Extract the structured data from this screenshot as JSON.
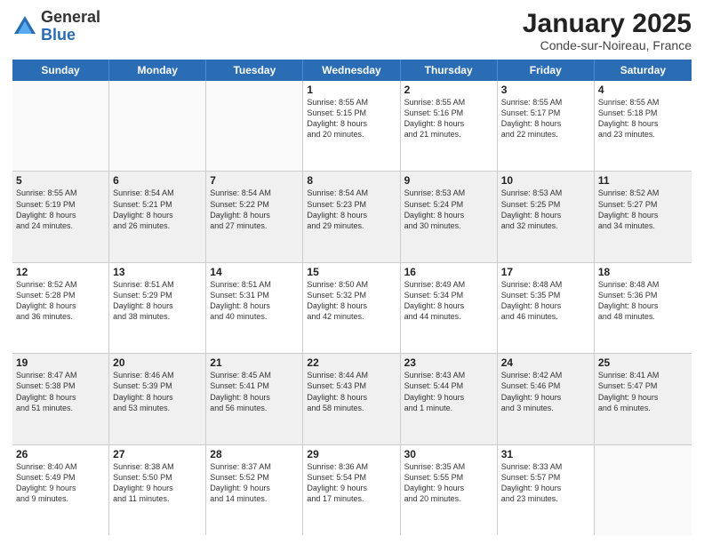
{
  "header": {
    "logo_general": "General",
    "logo_blue": "Blue",
    "title": "January 2025",
    "location": "Conde-sur-Noireau, France"
  },
  "calendar": {
    "days_of_week": [
      "Sunday",
      "Monday",
      "Tuesday",
      "Wednesday",
      "Thursday",
      "Friday",
      "Saturday"
    ],
    "weeks": [
      [
        {
          "day": "",
          "text": ""
        },
        {
          "day": "",
          "text": ""
        },
        {
          "day": "",
          "text": ""
        },
        {
          "day": "1",
          "text": "Sunrise: 8:55 AM\nSunset: 5:15 PM\nDaylight: 8 hours\nand 20 minutes."
        },
        {
          "day": "2",
          "text": "Sunrise: 8:55 AM\nSunset: 5:16 PM\nDaylight: 8 hours\nand 21 minutes."
        },
        {
          "day": "3",
          "text": "Sunrise: 8:55 AM\nSunset: 5:17 PM\nDaylight: 8 hours\nand 22 minutes."
        },
        {
          "day": "4",
          "text": "Sunrise: 8:55 AM\nSunset: 5:18 PM\nDaylight: 8 hours\nand 23 minutes."
        }
      ],
      [
        {
          "day": "5",
          "text": "Sunrise: 8:55 AM\nSunset: 5:19 PM\nDaylight: 8 hours\nand 24 minutes."
        },
        {
          "day": "6",
          "text": "Sunrise: 8:54 AM\nSunset: 5:21 PM\nDaylight: 8 hours\nand 26 minutes."
        },
        {
          "day": "7",
          "text": "Sunrise: 8:54 AM\nSunset: 5:22 PM\nDaylight: 8 hours\nand 27 minutes."
        },
        {
          "day": "8",
          "text": "Sunrise: 8:54 AM\nSunset: 5:23 PM\nDaylight: 8 hours\nand 29 minutes."
        },
        {
          "day": "9",
          "text": "Sunrise: 8:53 AM\nSunset: 5:24 PM\nDaylight: 8 hours\nand 30 minutes."
        },
        {
          "day": "10",
          "text": "Sunrise: 8:53 AM\nSunset: 5:25 PM\nDaylight: 8 hours\nand 32 minutes."
        },
        {
          "day": "11",
          "text": "Sunrise: 8:52 AM\nSunset: 5:27 PM\nDaylight: 8 hours\nand 34 minutes."
        }
      ],
      [
        {
          "day": "12",
          "text": "Sunrise: 8:52 AM\nSunset: 5:28 PM\nDaylight: 8 hours\nand 36 minutes."
        },
        {
          "day": "13",
          "text": "Sunrise: 8:51 AM\nSunset: 5:29 PM\nDaylight: 8 hours\nand 38 minutes."
        },
        {
          "day": "14",
          "text": "Sunrise: 8:51 AM\nSunset: 5:31 PM\nDaylight: 8 hours\nand 40 minutes."
        },
        {
          "day": "15",
          "text": "Sunrise: 8:50 AM\nSunset: 5:32 PM\nDaylight: 8 hours\nand 42 minutes."
        },
        {
          "day": "16",
          "text": "Sunrise: 8:49 AM\nSunset: 5:34 PM\nDaylight: 8 hours\nand 44 minutes."
        },
        {
          "day": "17",
          "text": "Sunrise: 8:48 AM\nSunset: 5:35 PM\nDaylight: 8 hours\nand 46 minutes."
        },
        {
          "day": "18",
          "text": "Sunrise: 8:48 AM\nSunset: 5:36 PM\nDaylight: 8 hours\nand 48 minutes."
        }
      ],
      [
        {
          "day": "19",
          "text": "Sunrise: 8:47 AM\nSunset: 5:38 PM\nDaylight: 8 hours\nand 51 minutes."
        },
        {
          "day": "20",
          "text": "Sunrise: 8:46 AM\nSunset: 5:39 PM\nDaylight: 8 hours\nand 53 minutes."
        },
        {
          "day": "21",
          "text": "Sunrise: 8:45 AM\nSunset: 5:41 PM\nDaylight: 8 hours\nand 56 minutes."
        },
        {
          "day": "22",
          "text": "Sunrise: 8:44 AM\nSunset: 5:43 PM\nDaylight: 8 hours\nand 58 minutes."
        },
        {
          "day": "23",
          "text": "Sunrise: 8:43 AM\nSunset: 5:44 PM\nDaylight: 9 hours\nand 1 minute."
        },
        {
          "day": "24",
          "text": "Sunrise: 8:42 AM\nSunset: 5:46 PM\nDaylight: 9 hours\nand 3 minutes."
        },
        {
          "day": "25",
          "text": "Sunrise: 8:41 AM\nSunset: 5:47 PM\nDaylight: 9 hours\nand 6 minutes."
        }
      ],
      [
        {
          "day": "26",
          "text": "Sunrise: 8:40 AM\nSunset: 5:49 PM\nDaylight: 9 hours\nand 9 minutes."
        },
        {
          "day": "27",
          "text": "Sunrise: 8:38 AM\nSunset: 5:50 PM\nDaylight: 9 hours\nand 11 minutes."
        },
        {
          "day": "28",
          "text": "Sunrise: 8:37 AM\nSunset: 5:52 PM\nDaylight: 9 hours\nand 14 minutes."
        },
        {
          "day": "29",
          "text": "Sunrise: 8:36 AM\nSunset: 5:54 PM\nDaylight: 9 hours\nand 17 minutes."
        },
        {
          "day": "30",
          "text": "Sunrise: 8:35 AM\nSunset: 5:55 PM\nDaylight: 9 hours\nand 20 minutes."
        },
        {
          "day": "31",
          "text": "Sunrise: 8:33 AM\nSunset: 5:57 PM\nDaylight: 9 hours\nand 23 minutes."
        },
        {
          "day": "",
          "text": ""
        }
      ]
    ]
  }
}
